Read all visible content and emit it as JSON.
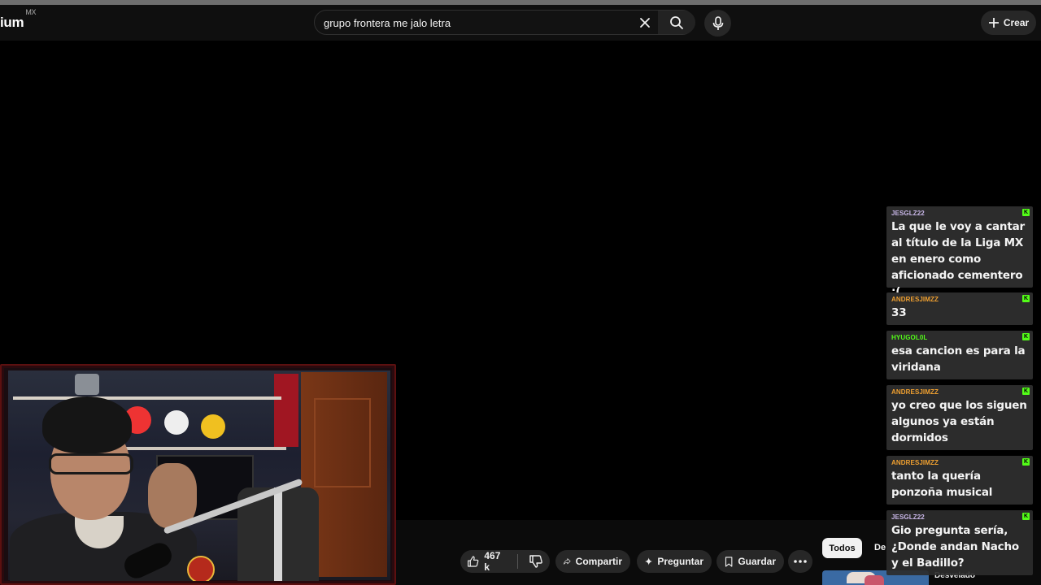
{
  "masthead": {
    "logo_text": "ium",
    "region": "MX",
    "search_value": "grupo frontera me jalo letra",
    "create_label": "Crear"
  },
  "actions": {
    "like_count": "467 k",
    "share_label": "Compartir",
    "ask_label": "Preguntar",
    "save_label": "Guardar"
  },
  "related": {
    "chip_all": "Todos",
    "chip_de": "De",
    "next_title": "Desvelado"
  },
  "chat": [
    {
      "user": "JESGLZ22",
      "color": "#c9b7e8",
      "message": "La que le voy a cantar al título de la Liga MX en enero como aficionado cementero :("
    },
    {
      "user": "ANDRESJIMZZ",
      "color": "#f0a030",
      "message": "33"
    },
    {
      "user": "HYUGOL0L",
      "color": "#53fc18",
      "message": "esa cancion es para la viridana"
    },
    {
      "user": "ANDRESJIMZZ",
      "color": "#f0a030",
      "message": "yo creo que los siguen algunos ya están dormidos"
    },
    {
      "user": "ANDRESJIMZZ",
      "color": "#f0a030",
      "message": "tanto la quería ponzoña musical"
    },
    {
      "user": "JESGLZ22",
      "color": "#c9b7e8",
      "message": "Gio pregunta sería, ¿Donde andan Nacho y el Badillo?"
    }
  ],
  "colors": {
    "kick_green": "#53fc18",
    "background": "#000000",
    "pill": "#272727"
  },
  "icons": [
    "close-icon",
    "search-icon",
    "mic-icon",
    "plus-icon",
    "thumbs-up-icon",
    "thumbs-down-icon",
    "share-icon",
    "sparkle-icon",
    "bookmark-icon",
    "more-icon",
    "kick-icon"
  ]
}
